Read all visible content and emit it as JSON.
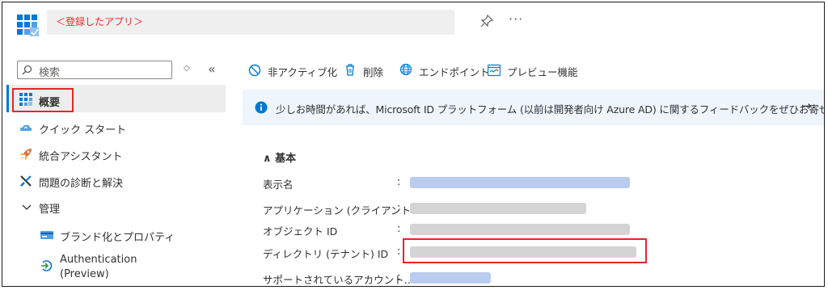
{
  "header": {
    "title": "＜登録したアプリ＞",
    "more_label": "···"
  },
  "sidebar": {
    "search_placeholder": "検索",
    "updown_label": "◇",
    "collapse_label": "«",
    "items": [
      {
        "label": "概要",
        "icon": "overview-grid-icon",
        "selected": true
      },
      {
        "label": "クイック スタート",
        "icon": "quickstart-cloud-icon"
      },
      {
        "label": "統合アシスタント",
        "icon": "rocket-icon"
      },
      {
        "label": "問題の診断と解決",
        "icon": "wrench-icon"
      },
      {
        "label": "管理",
        "icon": "chevron-down-icon"
      },
      {
        "label": "ブランド化とプロパティ",
        "icon": "branding-card-icon"
      },
      {
        "label": "Authentication",
        "label2": "(Preview)",
        "icon": "authentication-icon"
      }
    ]
  },
  "toolbar": {
    "deactivate": "非アクティブ化",
    "delete": "削除",
    "endpoints": "エンドポイント",
    "preview": "プレビュー機能"
  },
  "banner": {
    "text": "少しお時間があれば、Microsoft ID プラットフォーム (以前は開発者向け Azure AD) に関するフィードバックをぜひお寄せください。",
    "arrow": "→"
  },
  "essentials": {
    "heading": "∧ 基本",
    "rows": [
      {
        "label": "表示名",
        "value_style": "link"
      },
      {
        "label": "アプリケーション (クライアント…",
        "value_style": "text"
      },
      {
        "label": "オブジェクト ID",
        "value_style": "text"
      },
      {
        "label": "ディレクトリ (テナント) ID",
        "value_style": "text"
      },
      {
        "label": "サポートされているアカウント…",
        "value_style": "link"
      }
    ],
    "colon": ":"
  },
  "colors": {
    "accent": "#0078d4",
    "highlight_red": "#e4252b",
    "title_red": "#e8282d",
    "banner_bg": "#eef5fc"
  }
}
